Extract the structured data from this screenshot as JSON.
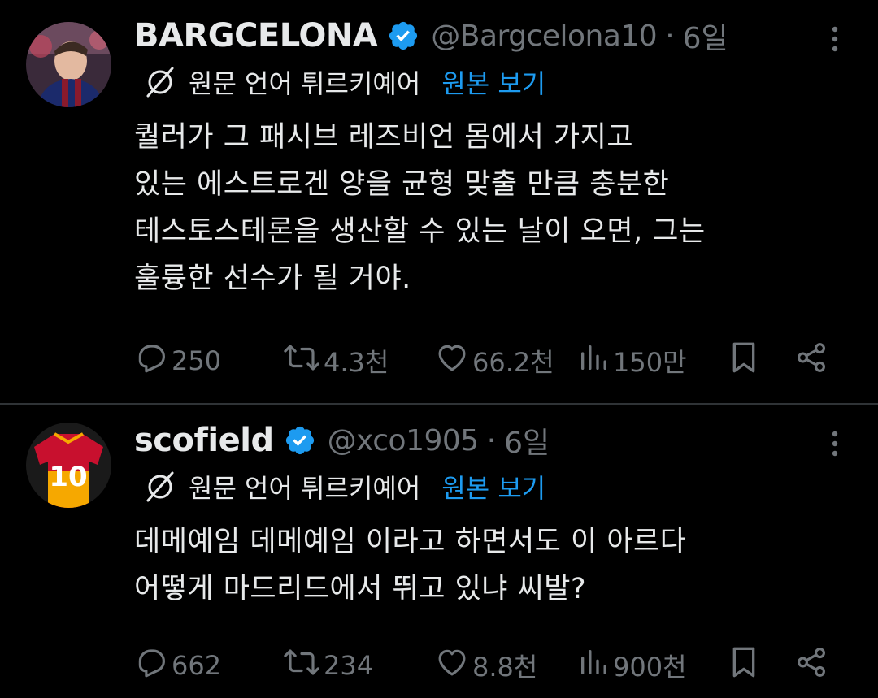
{
  "tweets": [
    {
      "display_name": "BARGCELONA",
      "handle": "@Bargcelona10",
      "separator": "·",
      "time": "6일",
      "translation_notice": "원문 언어 튀르키예어",
      "show_original": "원본 보기",
      "lines": [
        "퀄러가 그 패시브 레즈비언 몸에서 가지고",
        "있는 에스트로겐 양을 균형 맞출 만큼 충분한",
        "테스토스테론을 생산할 수 있는 날이 오면, 그는",
        "훌륭한 선수가 될 거야."
      ],
      "stats": {
        "replies": "250",
        "reposts": "4.3천",
        "likes": "66.2천",
        "views": "150만"
      }
    },
    {
      "display_name": "scofield",
      "handle": "@xco1905",
      "separator": "·",
      "time": "6일",
      "translation_notice": "원문 언어 튀르키예어",
      "show_original": "원본 보기",
      "lines": [
        "데메예임 데메예임 이라고 하면서도 이 아르다",
        "어떻게 마드리드에서 뛰고 있냐 씨발?"
      ],
      "stats": {
        "replies": "662",
        "reposts": "234",
        "likes": "8.8천",
        "views": "900천"
      }
    }
  ],
  "icons": {
    "more": "more-vertical-icon",
    "verified": "verified-badge-icon",
    "translate": "translate-icon",
    "reply": "reply-icon",
    "repost": "repost-icon",
    "like": "heart-icon",
    "views": "views-icon",
    "bookmark": "bookmark-icon",
    "share": "share-icon"
  },
  "colors": {
    "background": "#000000",
    "text": "#e7e9ea",
    "muted": "#71767b",
    "link": "#1d9bf0",
    "verified": "#1d9bf0",
    "divider": "#2f3336"
  }
}
